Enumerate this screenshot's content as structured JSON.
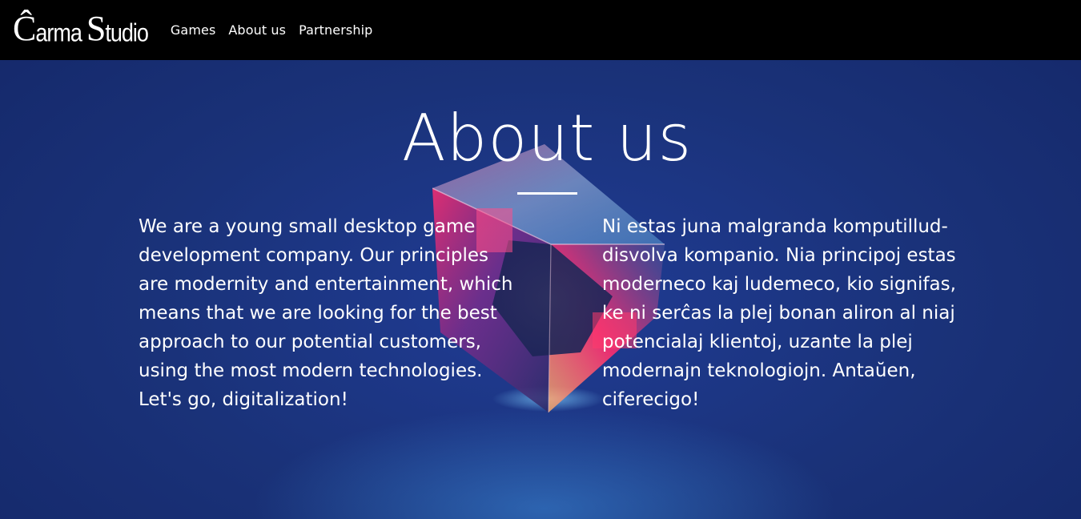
{
  "nav": {
    "logo_parts": [
      "Ĉ",
      "arma",
      "S",
      "tudio"
    ],
    "links": [
      "Games",
      "About us",
      "Partnership"
    ]
  },
  "hero": {
    "title": "About us",
    "text_en": "We are a young small desktop game development company. Our principles are modernity and entertainment, which means that we are looking for the best approach to our potential customers, using the most modern technologies. Let's go, digitalization!",
    "text_eo": "Ni estas juna malgranda komputillud-disvolva kompanio. Nia principoj estas moderneco kaj ludemeco, kio signifas, ke ni serĉas la plej bonan aliron al niaj potencialaj klientoj, uzante la plej modernajn teknologiojn. Antaŭen, ciferecigo!"
  },
  "colors": {
    "nav_bg": "#000000",
    "hero_bg": "#1a3279",
    "text": "#ffffff",
    "cube_glow": "#ff2d6f"
  }
}
